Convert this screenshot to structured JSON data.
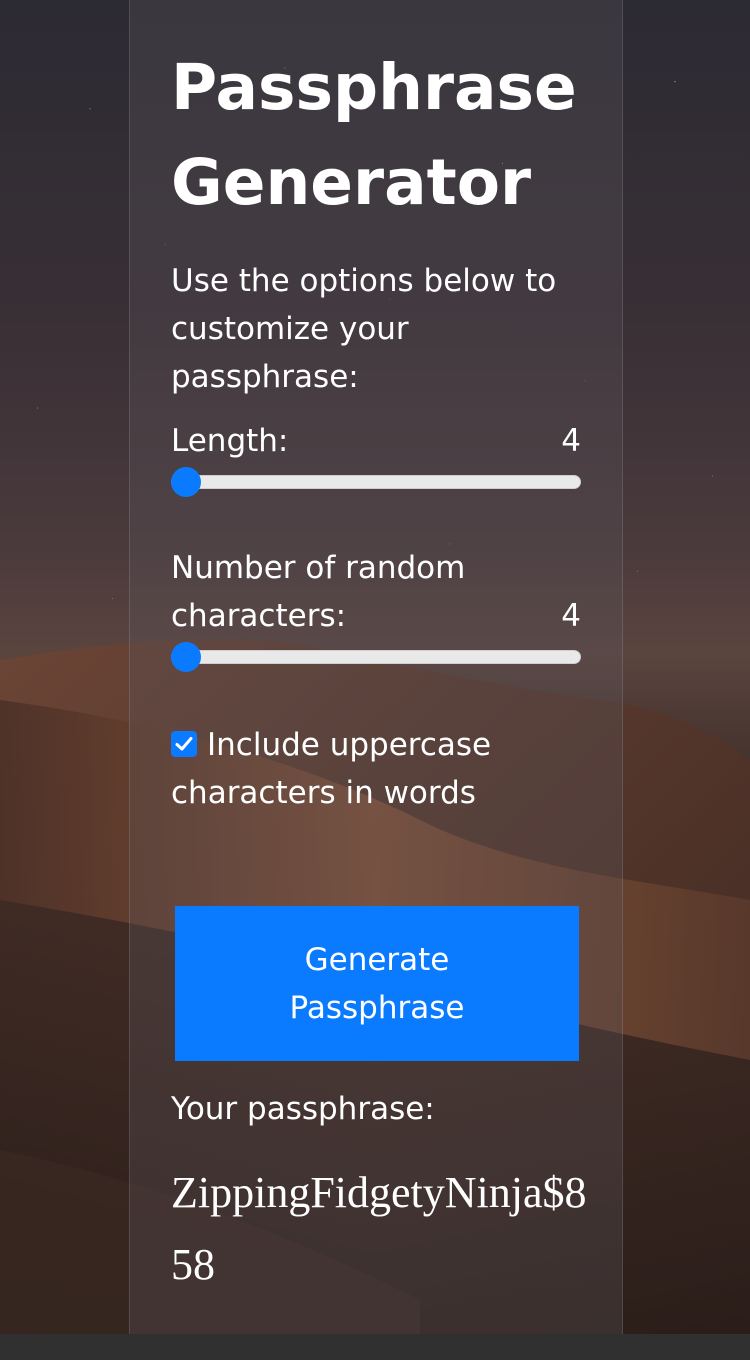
{
  "app": {
    "title": "Passphrase Generator",
    "intro": "Use the options below to customize your passphrase:"
  },
  "length_option": {
    "label": "Length:",
    "value": "4",
    "slider_fraction": 0.0
  },
  "random_chars_option": {
    "label": "Number of random characters:",
    "value": "4",
    "slider_fraction": 0.0
  },
  "uppercase_option": {
    "label": "Include uppercase characters in words",
    "checked": true
  },
  "generate_button": {
    "label": "Generate Passphrase"
  },
  "result": {
    "label": "Your passphrase:",
    "passphrase": "ZippingFidgetyNinja$858"
  },
  "colors": {
    "accent": "#0a7bff",
    "text": "#ffffff"
  }
}
